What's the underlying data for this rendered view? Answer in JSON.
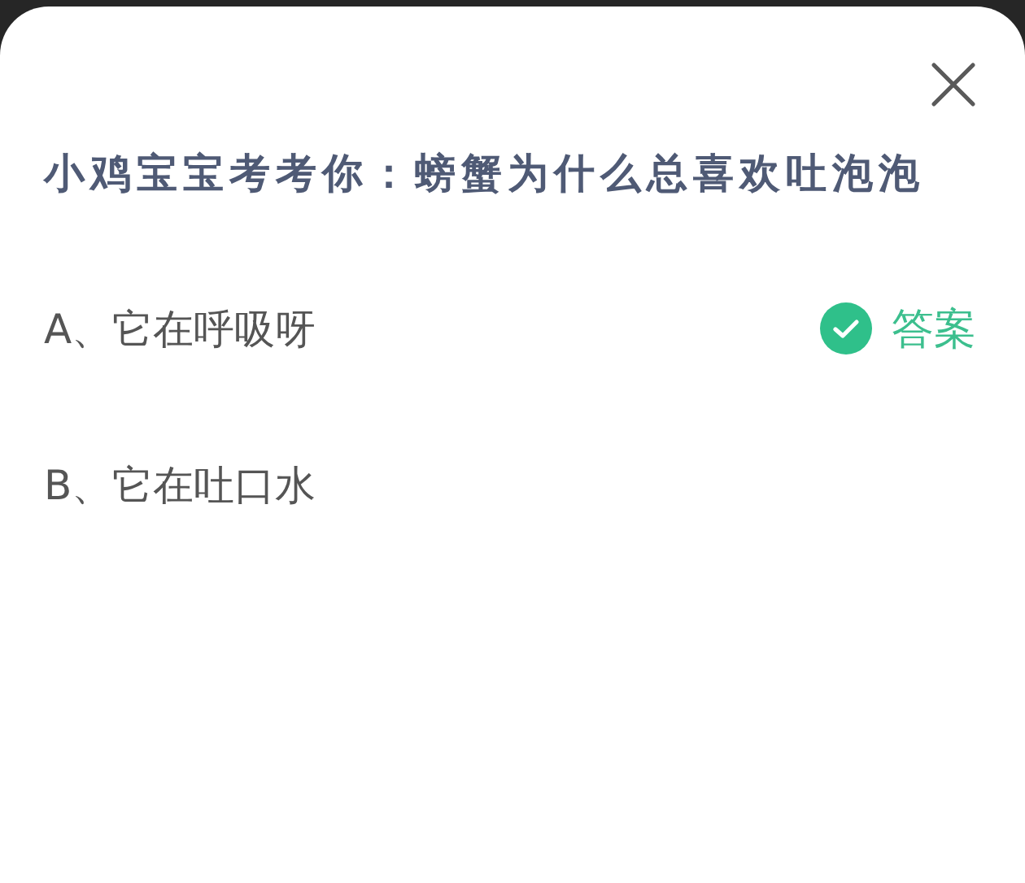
{
  "question": "小鸡宝宝考考你：螃蟹为什么总喜欢吐泡泡",
  "answer_label": "答案",
  "options": [
    {
      "label": "A、它在呼吸呀",
      "correct": true
    },
    {
      "label": "B、它在吐口水",
      "correct": false
    }
  ]
}
